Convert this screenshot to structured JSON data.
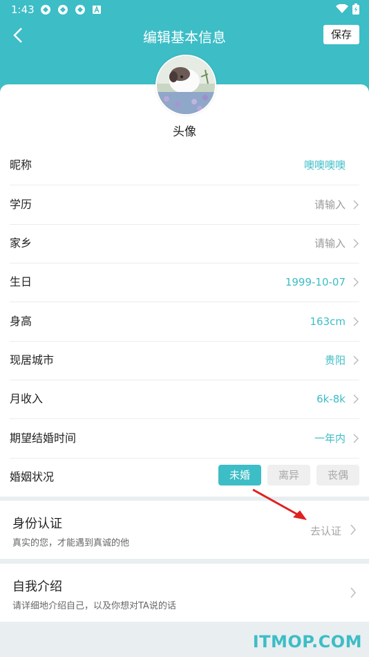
{
  "status": {
    "time": "1:43",
    "left_icons": [
      "sync-icon",
      "sync-icon",
      "sync-icon",
      "a-badge-icon"
    ],
    "right_icons": [
      "wifi-icon",
      "battery-icon"
    ]
  },
  "nav": {
    "title": "编辑基本信息",
    "save_label": "保存"
  },
  "avatar": {
    "label": "头像"
  },
  "rows": [
    {
      "label": "昵称",
      "value": "噢噢噢噢",
      "style": "teal",
      "chevron": false
    },
    {
      "label": "学历",
      "value": "请输入",
      "style": "gray",
      "chevron": true
    },
    {
      "label": "家乡",
      "value": "请输入",
      "style": "gray",
      "chevron": true
    },
    {
      "label": "生日",
      "value": "1999-10-07",
      "style": "teal",
      "chevron": true
    },
    {
      "label": "身高",
      "value": "163cm",
      "style": "teal",
      "chevron": true
    },
    {
      "label": "现居城市",
      "value": "贵阳",
      "style": "teal",
      "chevron": true
    },
    {
      "label": "月收入",
      "value": "6k-8k",
      "style": "teal",
      "chevron": true
    },
    {
      "label": "期望结婚时间",
      "value": "一年内",
      "style": "teal",
      "chevron": true
    }
  ],
  "marital": {
    "label": "婚姻状况",
    "options": [
      "未婚",
      "离异",
      "丧偶"
    ],
    "selected": "未婚"
  },
  "identity": {
    "title": "身份认证",
    "subtitle": "真实的您，才能遇到真诚的他",
    "action": "去认证"
  },
  "intro": {
    "title": "自我介绍",
    "subtitle": "请详细地介绍自己，以及你想对TA说的话"
  },
  "watermark": "ITMOP.COM",
  "colors": {
    "accent": "#3dbdc6",
    "background": "#e9eef0",
    "arrow": "#e02020"
  }
}
